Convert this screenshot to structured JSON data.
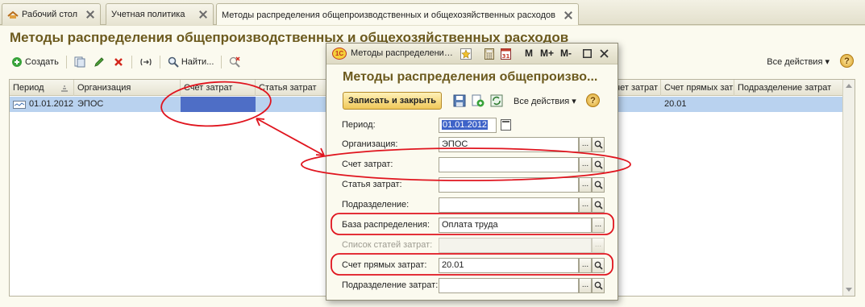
{
  "tabs": [
    {
      "label": "Рабочий стол"
    },
    {
      "label": "Учетная политика"
    },
    {
      "label": "Методы распределения общепроизводственных и общехозяйственных расходов"
    }
  ],
  "main": {
    "title": "Методы распределения общепроизводственных и общехозяйственных расходов",
    "toolbar": {
      "create": "Создать",
      "find": "Найти...",
      "all_actions": "Все действия",
      "help": "?"
    },
    "table": {
      "columns": [
        "Период",
        "Организация",
        "Счет затрат",
        "Статья затрат",
        "Счет затрат",
        "Счет прямых затрат",
        "Подразделение затрат"
      ],
      "rows": [
        {
          "period": "01.01.2012",
          "organization": "ЭПОС",
          "cost_account": "",
          "cost_item": "",
          "direct_account": "20.01",
          "department": ""
        }
      ]
    }
  },
  "dialog": {
    "window_title": "Методы распределения...",
    "window_controls": {
      "m": "M",
      "m_plus": "M+",
      "m_minus": "M-"
    },
    "logo": "1С",
    "heading": "Методы распределения общепроизво...",
    "save_close": "Записать и закрыть",
    "all_actions": "Все действия",
    "help": "?",
    "fields": [
      {
        "label": "Период:",
        "value": "01.01.2012"
      },
      {
        "label": "Организация:",
        "value": "ЭПОС"
      },
      {
        "label": "Счет затрат:",
        "value": ""
      },
      {
        "label": "Статья затрат:",
        "value": ""
      },
      {
        "label": "Подразделение:",
        "value": ""
      },
      {
        "label": "База распределения:",
        "value": "Оплата труда"
      },
      {
        "label": "Список статей затрат:",
        "value": ""
      },
      {
        "label": "Счет прямых затрат:",
        "value": "20.01"
      },
      {
        "label": "Подразделение затрат:",
        "value": ""
      }
    ],
    "select_glyph": "...",
    "search_glyph": "Q"
  },
  "colors": {
    "accent_title": "#6c5a1e",
    "selection_row": "#b9d2ef",
    "selected_cell": "#4e6ec6",
    "annotation_red": "#e0141e"
  }
}
